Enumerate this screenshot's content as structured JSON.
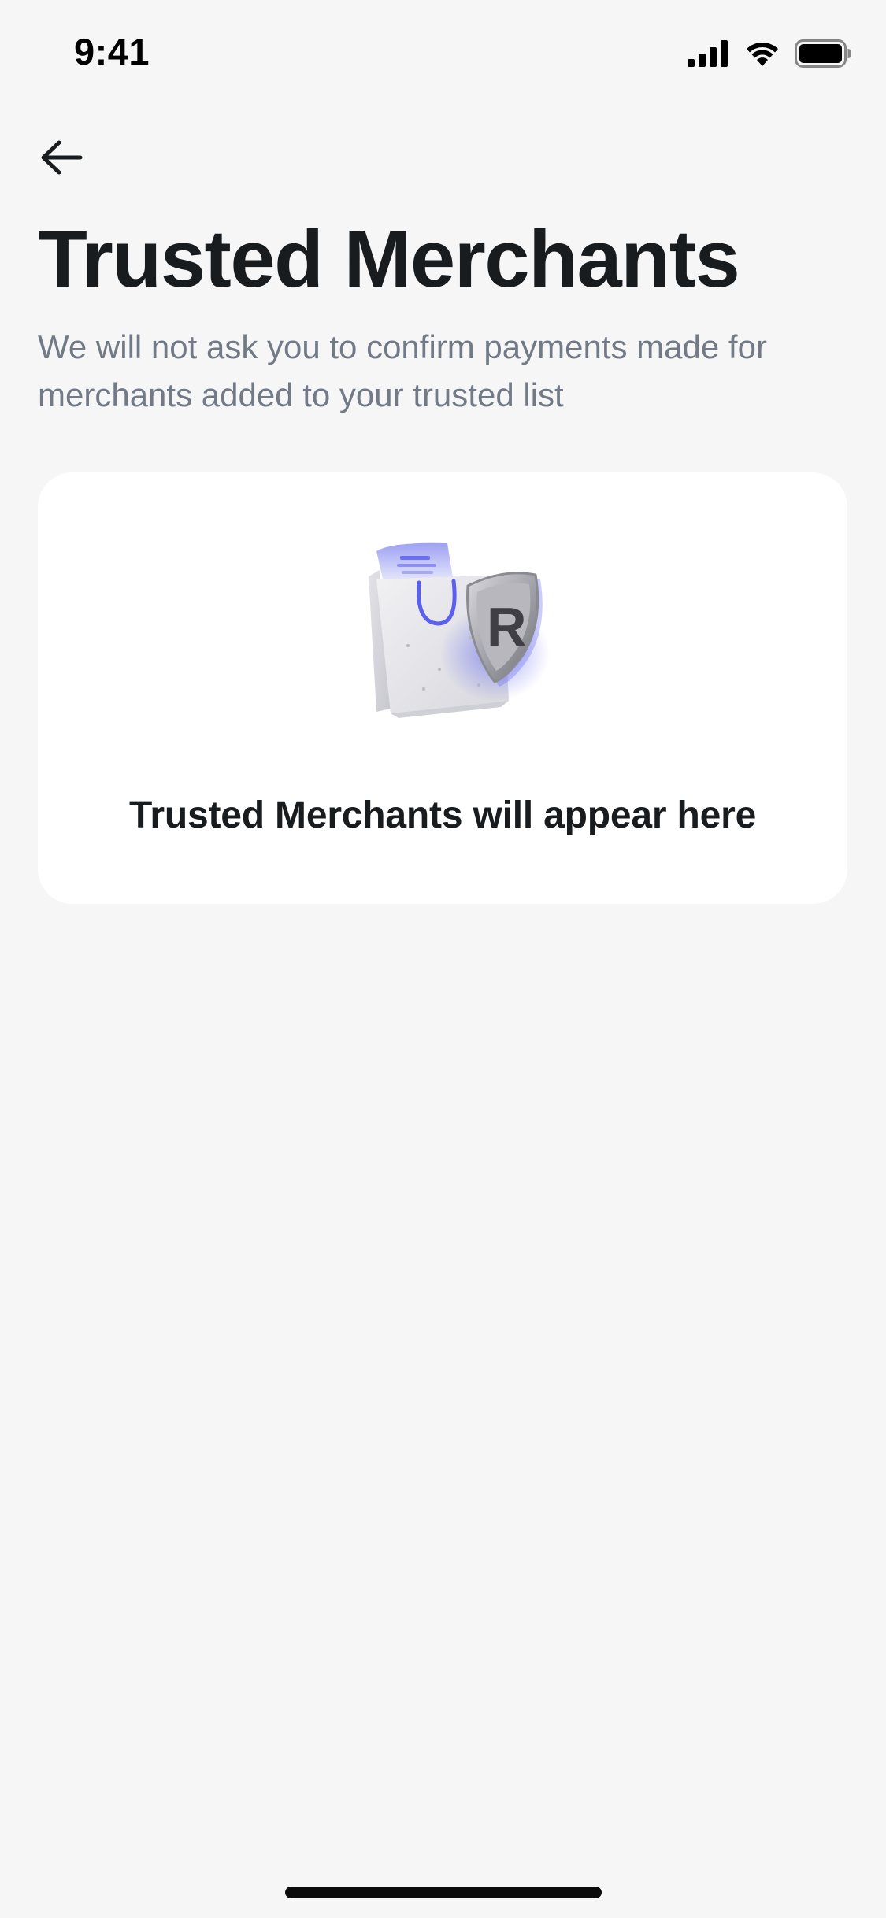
{
  "status_bar": {
    "time": "9:41",
    "icons": [
      "cellular-signal-icon",
      "wifi-icon",
      "battery-icon"
    ]
  },
  "header": {
    "back_icon": "arrow-left-icon"
  },
  "page": {
    "title": "Trusted Merchants",
    "description": "We will not ask you to confirm payments made for merchants added to your trusted list"
  },
  "empty_state": {
    "illustration": "shopping-bag-shield-illustration",
    "message": "Trusted Merchants will appear here"
  },
  "colors": {
    "background": "#f6f6f6",
    "card": "#ffffff",
    "title": "#191c1f",
    "description": "#717a86",
    "accent": "#5b5ff0"
  }
}
